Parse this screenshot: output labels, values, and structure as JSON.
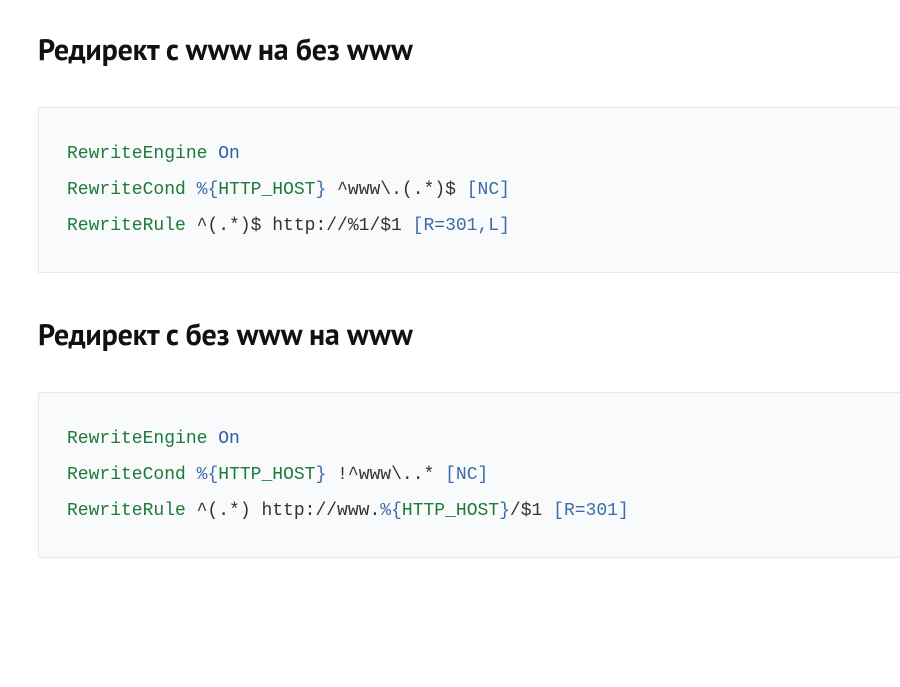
{
  "sections": [
    {
      "heading": "Редирект с www на без www",
      "code": {
        "l1": {
          "directive": "RewriteEngine",
          "value": "On"
        },
        "l2": {
          "directive": "RewriteCond",
          "pct": "%",
          "lb": "{",
          "varname": "HTTP_HOST",
          "rb": "}",
          "pattern": " ^www\\.(.*)$ ",
          "flags": "[NC]"
        },
        "l3": {
          "directive": "RewriteRule",
          "pattern": " ^(.*)$ http://%1/$1 ",
          "flags": "[R=301,L]"
        }
      }
    },
    {
      "heading": "Редирект с без www на www",
      "code": {
        "l1": {
          "directive": "RewriteEngine",
          "value": "On"
        },
        "l2": {
          "directive": "RewriteCond",
          "pct": "%",
          "lb": "{",
          "varname": "HTTP_HOST",
          "rb": "}",
          "pattern": " !^www\\..* ",
          "flags": "[NC]"
        },
        "l3": {
          "directive": "RewriteRule",
          "pattern": " ^(.*) http://www.",
          "pct2": "%",
          "lb2": "{",
          "varname2": "HTTP_HOST",
          "rb2": "}",
          "tail": "/$1 ",
          "flags": "[R=301]"
        }
      }
    }
  ]
}
